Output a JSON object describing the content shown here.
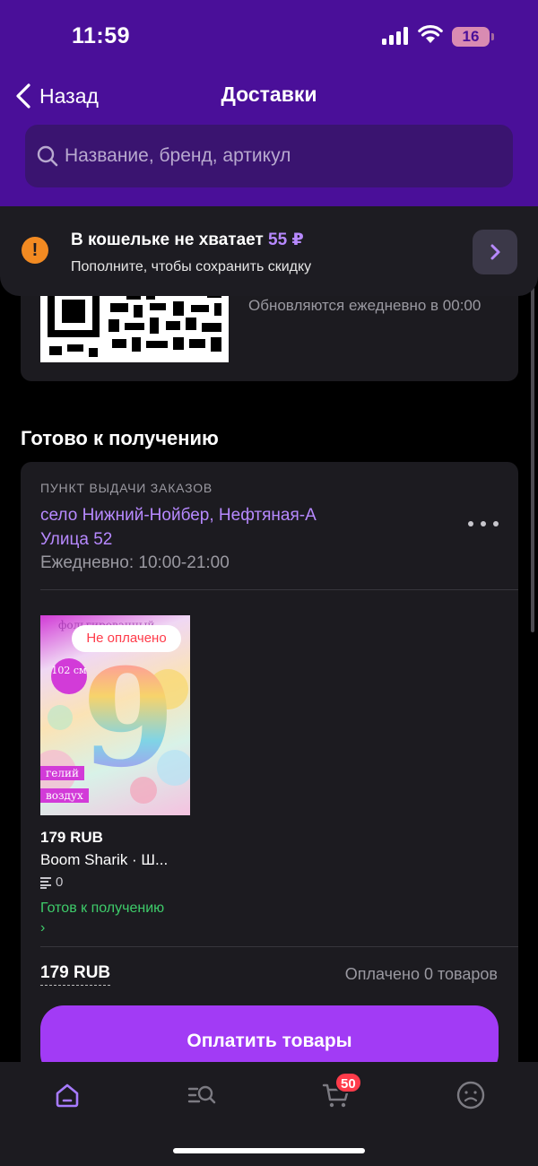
{
  "status_bar": {
    "time": "11:59",
    "battery": "16",
    "signal_icon": "signal-icon",
    "wifi_icon": "wifi-icon"
  },
  "nav": {
    "back_label": "Назад",
    "title": "Доставки"
  },
  "search": {
    "placeholder": "Название, бренд, артикул"
  },
  "wallet_banner": {
    "title": "В кошельке не хватает",
    "amount": "55 ₽",
    "subtitle": "Пополните, чтобы сохранить скидку",
    "icon": "warning-icon",
    "accent_color": "#b789ff"
  },
  "qr_card": {
    "note": "Обновляются ежедневно в 00:00"
  },
  "section_title": "Готово к получению",
  "pickup": {
    "label": "ПУНКТ ВЫДАЧИ ЗАКАЗОВ",
    "address_line1": "село Нижний-Нойбер, Нефтяная-А",
    "address_line2": "Улица 52",
    "hours": "Ежедневно: 10:00-21:00",
    "item": {
      "badge": "Не оплачено",
      "image_text_top": "фольгированный",
      "image_chip": "102 см",
      "image_tag1": "гелий",
      "image_tag2": "воздух",
      "price": "179 RUB",
      "brand": "Boom Sharik · Ш...",
      "qty": "0",
      "status": "Готов к получению",
      "status_arrow": "›"
    },
    "total": "179 RUB",
    "paid_count": "Оплачено 0 товаров",
    "pay_button": "Оплатить товары"
  },
  "tabbar": {
    "items": [
      "home-icon",
      "catalog-search-icon",
      "cart-icon",
      "profile-icon"
    ],
    "cart_badge": "50",
    "active_color": "#a77bff"
  }
}
